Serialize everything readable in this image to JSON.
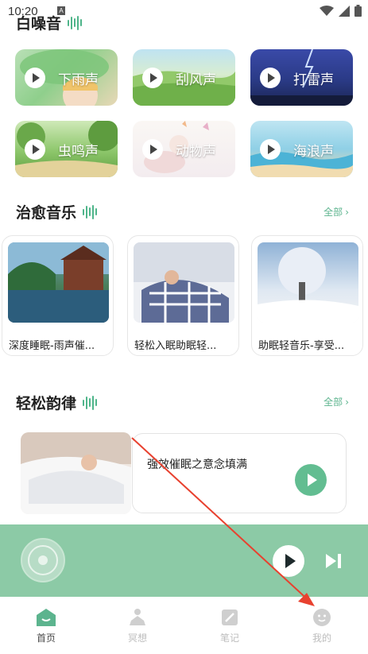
{
  "status_bar": {
    "time": "10:20",
    "notif_badge": "A"
  },
  "white_noise": {
    "title": "白噪音",
    "items": [
      {
        "label": "下雨声",
        "icon": "play-icon"
      },
      {
        "label": "刮风声",
        "icon": "play-icon"
      },
      {
        "label": "打雷声",
        "icon": "play-icon"
      },
      {
        "label": "虫鸣声",
        "icon": "play-icon"
      },
      {
        "label": "动物声",
        "icon": "play-icon"
      },
      {
        "label": "海浪声",
        "icon": "play-icon"
      }
    ]
  },
  "healing_music": {
    "title": "治愈音乐",
    "see_all": "全部",
    "items": [
      {
        "caption": "深度睡眠-雨声催..."
      },
      {
        "caption": "轻松入眠助眠轻..."
      },
      {
        "caption": "助眠轻音乐-享受..."
      }
    ]
  },
  "relax_rhythm": {
    "title": "轻松韵律",
    "see_all": "全部",
    "item": {
      "title": "强效催眠之意念填满"
    }
  },
  "tabs": [
    {
      "label": "首页",
      "icon": "home-icon",
      "active": true
    },
    {
      "label": "冥想",
      "icon": "meditation-icon",
      "active": false
    },
    {
      "label": "笔记",
      "icon": "note-icon",
      "active": false
    },
    {
      "label": "我的",
      "icon": "profile-icon",
      "active": false
    }
  ],
  "colors": {
    "accent": "#5cb48e",
    "player_bar": "#8ccaa6",
    "annotation_arrow": "#e8412f"
  }
}
